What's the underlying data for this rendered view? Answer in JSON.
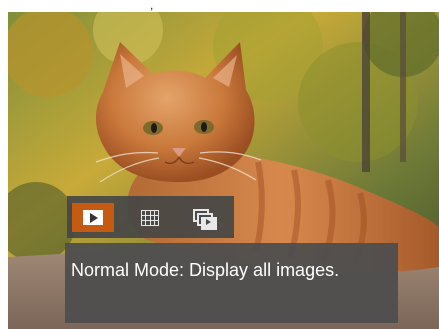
{
  "top_text": ",",
  "photo": {
    "icon": "photo-cat-image"
  },
  "mode_selector": {
    "selected_index": 0,
    "modes": [
      {
        "icon": "play-icon"
      },
      {
        "icon": "grid-icon"
      },
      {
        "icon": "slideshow-icon"
      }
    ],
    "selected_color": "#c55a13",
    "bar_color": "#464646"
  },
  "caption": {
    "text": "Normal Mode: Display all images."
  }
}
